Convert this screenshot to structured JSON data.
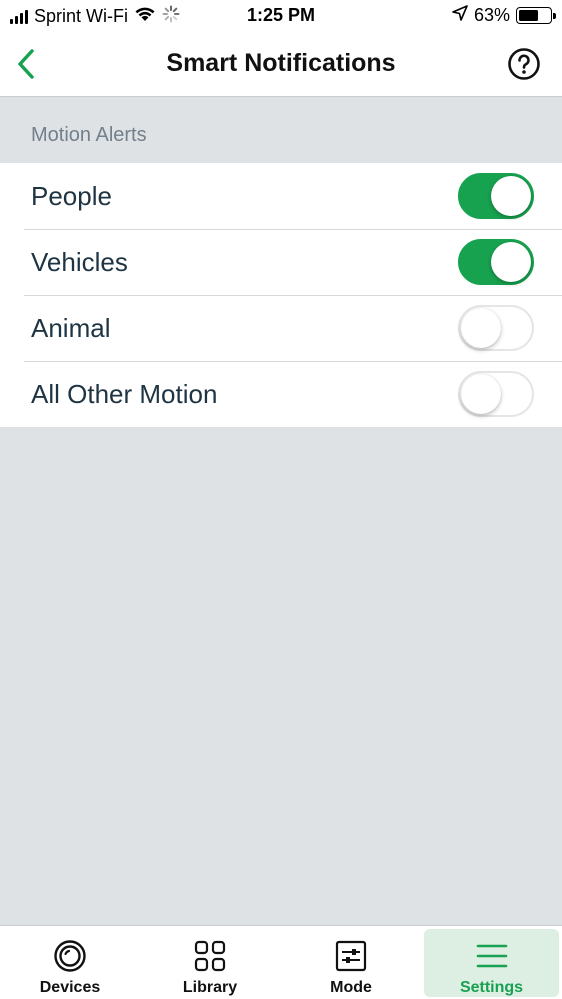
{
  "status_bar": {
    "carrier": "Sprint Wi-Fi",
    "time": "1:25 PM",
    "battery_percent": "63%",
    "battery_level": 0.63,
    "icons": [
      "signal-icon",
      "wifi-icon",
      "loading-spinner-icon",
      "location-arrow-icon",
      "battery-icon"
    ]
  },
  "nav": {
    "title": "Smart Notifications",
    "back_icon": "chevron-left-icon",
    "help_icon": "question-circle-icon"
  },
  "section": {
    "title": "Motion Alerts"
  },
  "settings": [
    {
      "label": "People",
      "enabled": true
    },
    {
      "label": "Vehicles",
      "enabled": true
    },
    {
      "label": "Animal",
      "enabled": false
    },
    {
      "label": "All Other Motion",
      "enabled": false
    }
  ],
  "tabs": [
    {
      "label": "Devices",
      "icon": "camera-lens-icon",
      "active": false
    },
    {
      "label": "Library",
      "icon": "grid-icon",
      "active": false
    },
    {
      "label": "Mode",
      "icon": "sliders-icon",
      "active": false
    },
    {
      "label": "Settings",
      "icon": "hamburger-menu-icon",
      "active": true
    }
  ],
  "colors": {
    "accent": "#17a24f",
    "active_tab_bg": "#dcefe2",
    "background": "#dfe2e5",
    "text": "#1f3442"
  }
}
